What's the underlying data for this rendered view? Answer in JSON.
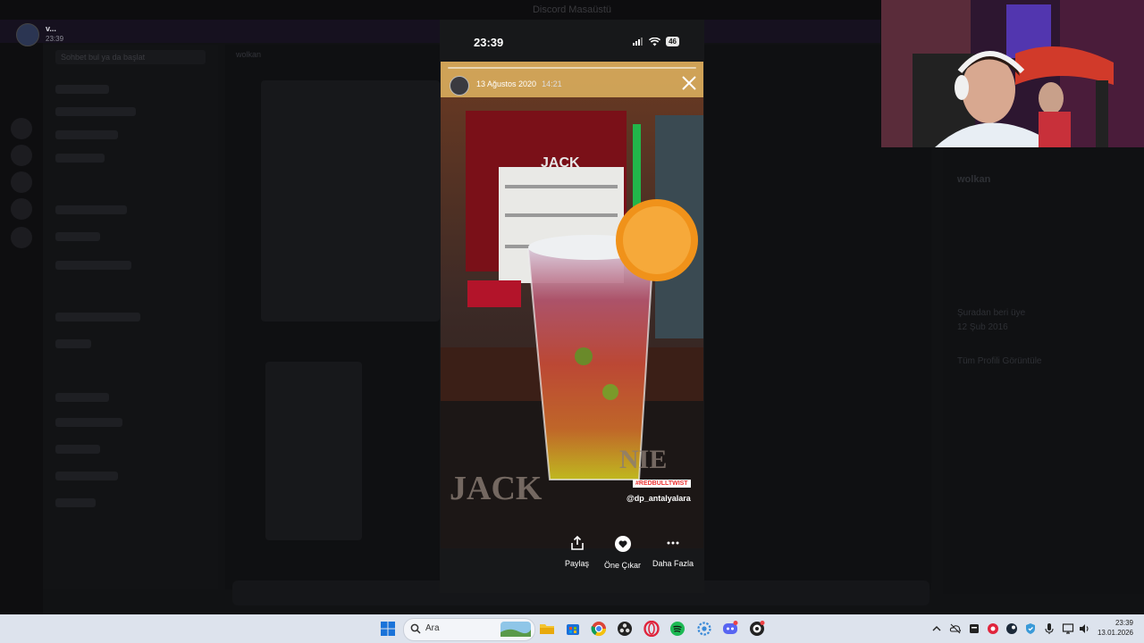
{
  "background_app": {
    "title": "Discord Masaüstü",
    "notification": {
      "name": "v...",
      "time": "23:39"
    },
    "search_placeholder": "Sohbet bul ya da başlat",
    "channel_name": "wolkan",
    "right_panel": {
      "name": "wolkan",
      "section_label": "Şuradan beri üye",
      "date": "12 Şub 2016",
      "link": "Tüm Profili Görüntüle"
    }
  },
  "phone": {
    "status_time": "23:39",
    "battery": "46",
    "story": {
      "date": "13 Ağustos 2020",
      "time": "14:21",
      "hashtag": "#REDBULLTWIST",
      "mention": "@dp_antalyalara"
    },
    "actions": [
      {
        "label": "Paylaş",
        "icon": "share-icon"
      },
      {
        "label": "Öne Çıkar",
        "icon": "heart-icon"
      },
      {
        "label": "Daha Fazla",
        "icon": "more-icon"
      }
    ]
  },
  "taskbar": {
    "search_label": "Ara",
    "clock_time": "23:39",
    "clock_date": "13.01.2026"
  }
}
